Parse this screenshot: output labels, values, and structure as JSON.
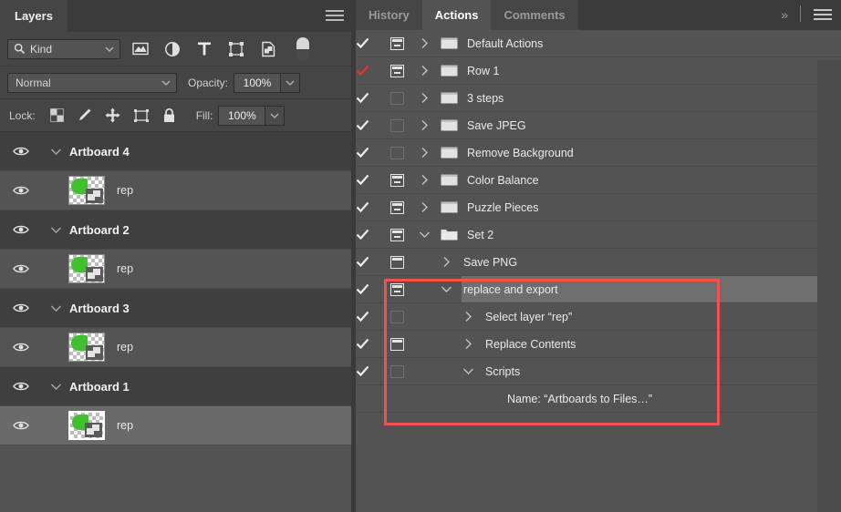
{
  "layers_panel": {
    "tab_label": "Layers",
    "menu_icon": "hamburger-menu-icon",
    "filter": {
      "search_icon": "search-icon",
      "kind_label": "Kind",
      "caret_icon": "chevron-down-icon",
      "filter_icons": [
        "pixel-layer-icon",
        "adjustment-layer-icon",
        "type-layer-icon",
        "shape-layer-icon",
        "smart-object-icon"
      ],
      "toggle_icon": "filter-toggle-switch"
    },
    "blend": {
      "mode_value": "Normal",
      "opacity_label": "Opacity:",
      "opacity_value": "100%",
      "caret_icon": "chevron-down-icon"
    },
    "lock": {
      "label": "Lock:",
      "icons": [
        "lock-transparent-pixels-icon",
        "lock-image-pixels-icon",
        "lock-position-icon",
        "lock-artboard-nesting-icon",
        "lock-all-icon"
      ],
      "fill_label": "Fill:",
      "fill_value": "100%"
    },
    "rows": [
      {
        "type": "artboard",
        "name": "Artboard 4",
        "eye": "eye-icon",
        "twisty": "chevron-down-icon",
        "selected": false
      },
      {
        "type": "layer",
        "name": "rep",
        "eye": "eye-icon",
        "thumb": "smart-object-thumbnail",
        "selected": false
      },
      {
        "type": "artboard",
        "name": "Artboard 2",
        "eye": "eye-icon",
        "twisty": "chevron-down-icon",
        "selected": false
      },
      {
        "type": "layer",
        "name": "rep",
        "eye": "eye-icon",
        "thumb": "smart-object-thumbnail",
        "selected": false
      },
      {
        "type": "artboard",
        "name": "Artboard 3",
        "eye": "eye-icon",
        "twisty": "chevron-down-icon",
        "selected": false
      },
      {
        "type": "layer",
        "name": "rep",
        "eye": "eye-icon",
        "thumb": "smart-object-thumbnail",
        "selected": false
      },
      {
        "type": "artboard",
        "name": "Artboard 1",
        "eye": "eye-icon",
        "twisty": "chevron-down-icon",
        "selected": false
      },
      {
        "type": "layer",
        "name": "rep",
        "eye": "eye-icon",
        "thumb": "smart-object-thumbnail",
        "selected": true
      }
    ]
  },
  "actions_panel": {
    "tabs": [
      {
        "label": "History",
        "active": false
      },
      {
        "label": "Actions",
        "active": true
      },
      {
        "label": "Comments",
        "active": false
      }
    ],
    "overflow_icon": "double-chevron-right-icon",
    "menu_icon": "hamburger-menu-icon",
    "rows": [
      {
        "name": "Default Actions",
        "check": "white",
        "toggle": "full",
        "twisty": "collapsed",
        "folder": true,
        "indent": 0,
        "selected": false
      },
      {
        "name": "Row 1",
        "check": "red",
        "toggle": "full",
        "twisty": "collapsed",
        "folder": true,
        "indent": 0,
        "selected": false
      },
      {
        "name": "3 steps",
        "check": "white",
        "toggle": "ghost",
        "twisty": "collapsed",
        "folder": true,
        "indent": 0,
        "selected": false
      },
      {
        "name": "Save JPEG",
        "check": "white",
        "toggle": "ghost",
        "twisty": "collapsed",
        "folder": true,
        "indent": 0,
        "selected": false
      },
      {
        "name": "Remove Background",
        "check": "white",
        "toggle": "ghost",
        "twisty": "collapsed",
        "folder": true,
        "indent": 0,
        "selected": false
      },
      {
        "name": "Color Balance",
        "check": "white",
        "toggle": "full",
        "twisty": "collapsed",
        "folder": true,
        "indent": 0,
        "selected": false
      },
      {
        "name": "Puzzle Pieces",
        "check": "white",
        "toggle": "full",
        "twisty": "collapsed",
        "folder": true,
        "indent": 0,
        "selected": false
      },
      {
        "name": "Set 2",
        "check": "white",
        "toggle": "full",
        "twisty": "expanded",
        "folder": true,
        "indent": 0,
        "selected": false
      },
      {
        "name": "Save PNG",
        "check": "white",
        "toggle": "plain",
        "twisty": "collapsed",
        "folder": false,
        "indent": 1,
        "selected": false
      },
      {
        "name": "replace and export",
        "check": "white",
        "toggle": "full",
        "twisty": "expanded",
        "folder": false,
        "indent": 1,
        "selected": true
      },
      {
        "name": "Select layer “rep”",
        "check": "white",
        "toggle": "ghost",
        "twisty": "collapsed",
        "folder": false,
        "indent": 2,
        "selected": false
      },
      {
        "name": "Replace Contents",
        "check": "white",
        "toggle": "plain",
        "twisty": "collapsed",
        "folder": false,
        "indent": 2,
        "selected": false
      },
      {
        "name": "Scripts",
        "check": "white",
        "toggle": "ghost",
        "twisty": "expanded",
        "folder": false,
        "indent": 2,
        "selected": false
      },
      {
        "name": "Name:  “Artboards to Files…”",
        "check": "none",
        "toggle": "none",
        "twisty": "none",
        "folder": false,
        "indent": 3,
        "selected": false
      }
    ],
    "highlight": {
      "color": "#f0534c",
      "label": "red-annotation-box"
    }
  }
}
